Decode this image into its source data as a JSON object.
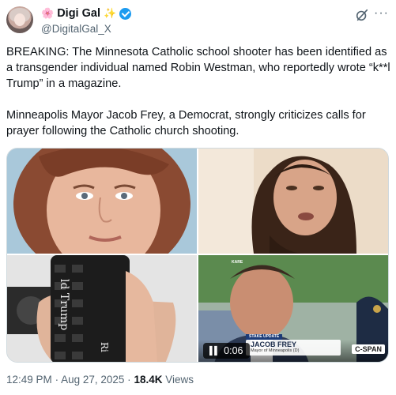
{
  "author": {
    "display_name": "Digi Gal",
    "name_emoji_left": "🌸",
    "name_emoji_right": "✨",
    "handle": "@DigitalGal_X",
    "verified": true,
    "verified_color": "#1d9bf0"
  },
  "header_icons": [
    "grok-icon",
    "more-icon"
  ],
  "tweet": {
    "paragraph_1": "BREAKING: The Minnesota Catholic school shooter has been identified as a transgender individual named Robin Westman, who reportedly wrote “k**l Trump” in a magazine.",
    "paragraph_2": "Minneapolis Mayor Jacob Frey, a Democrat, strongly criticizes calls for prayer following the Catholic church shooting."
  },
  "media": {
    "image_3_overlay_text": "ld Trump",
    "image_3_overlay_text_2": "Ri",
    "video": {
      "duration": "0:06",
      "chyron_label": "STAKE UPDATE",
      "chyron_name": "JACOB FREY",
      "chyron_title": "Mayor of Minneapolis (D)",
      "network": "C-SPAN",
      "corner_tag": "KARE"
    }
  },
  "meta": {
    "time": "12:49 PM",
    "separator": "·",
    "date": "Aug 27, 2025",
    "views_count": "18.4K",
    "views_label": "Views"
  },
  "colors": {
    "text_primary": "#0f1419",
    "text_secondary": "#536471",
    "border": "#cfd9de"
  }
}
